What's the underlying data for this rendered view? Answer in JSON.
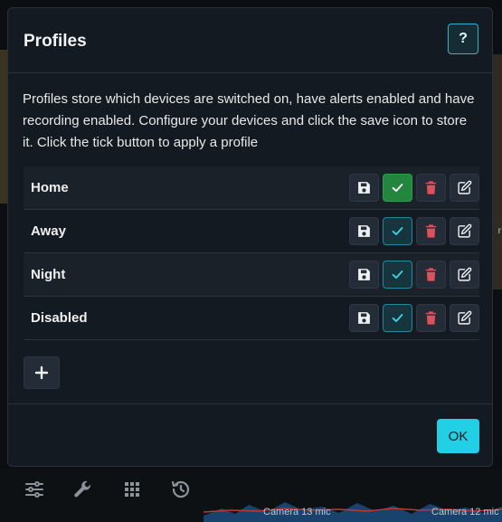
{
  "modal": {
    "title": "Profiles",
    "help_label": "?",
    "description": "Profiles store which devices are switched on, have alerts enabled and have recording enabled. Configure your devices and click the save icon to store it. Click the tick button to apply a profile",
    "ok_label": "OK"
  },
  "profiles": [
    {
      "name": "Home",
      "active": true
    },
    {
      "name": "Away",
      "active": false
    },
    {
      "name": "Night",
      "active": false
    },
    {
      "name": "Disabled",
      "active": false
    }
  ],
  "icons": {
    "save": "floppy-disk-icon",
    "apply": "check-icon",
    "delete": "trash-icon",
    "edit": "edit-icon",
    "add": "plus-icon",
    "help": "question-icon"
  },
  "colors": {
    "accent": "#21d0e4",
    "active_apply": "#23863e",
    "delete": "#e0505c",
    "modal_bg": "#141a22"
  },
  "background": {
    "camera_labels": [
      "Camera 13 mic",
      "Camera 12 mic"
    ],
    "edge_label": "r",
    "toolbar_icons": [
      "sliders-icon",
      "wrench-icon",
      "grid-icon",
      "history-icon"
    ]
  }
}
